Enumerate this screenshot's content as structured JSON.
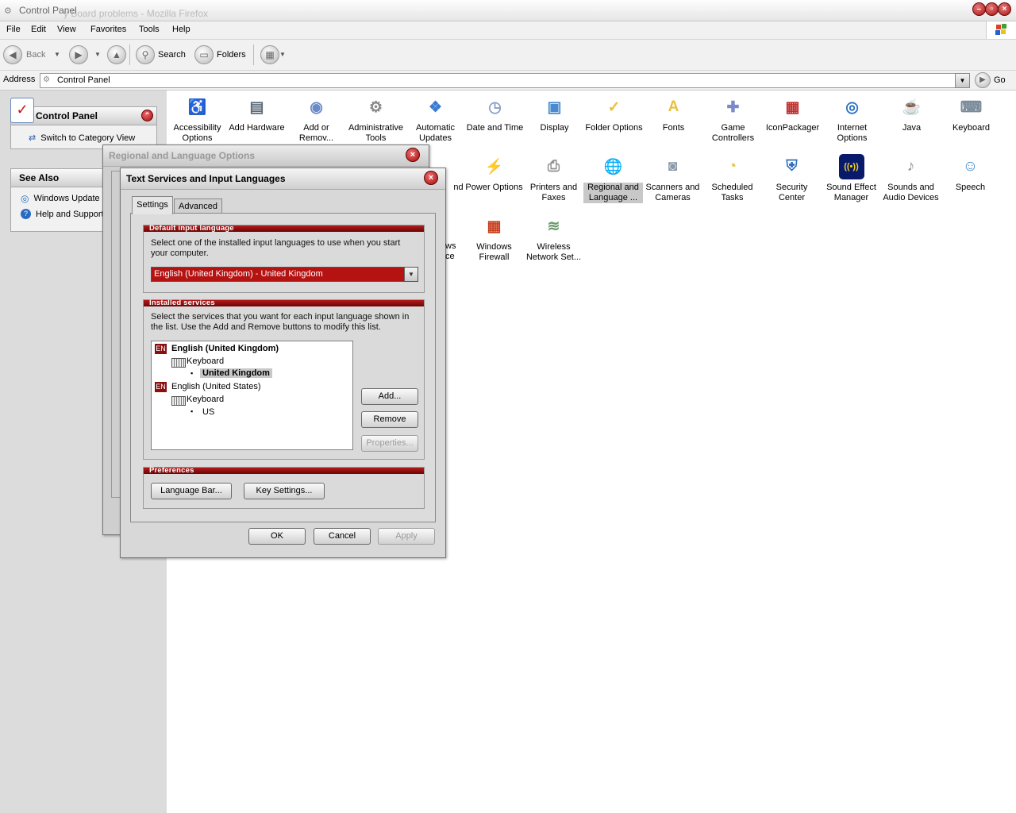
{
  "window": {
    "title": "Control Panel",
    "ghost_title": "y Board problems - Mozilla Firefox"
  },
  "menu": [
    "File",
    "Edit",
    "View",
    "Favorites",
    "Tools",
    "Help"
  ],
  "toolbar": {
    "back": "Back",
    "search": "Search",
    "folders": "Folders"
  },
  "address": {
    "label": "Address",
    "value": "Control Panel",
    "go": "Go"
  },
  "leftpane": {
    "control_panel_title": "Control Panel",
    "switch_view": "Switch to Category View",
    "see_also_title": "See Also",
    "see_also": [
      "Windows Update",
      "Help and Support"
    ]
  },
  "items": [
    {
      "label": "Accessibility Options",
      "icon": "accessibility-icon",
      "color": "#2e8b2e",
      "glyph": "♿"
    },
    {
      "label": "Add Hardware",
      "icon": "add-hardware-icon",
      "color": "#5a6a7a",
      "glyph": "▤"
    },
    {
      "label": "Add or Remov...",
      "icon": "add-remove-programs-icon",
      "color": "#6a8ac8",
      "glyph": "◉"
    },
    {
      "label": "Administrative Tools",
      "icon": "administrative-tools-icon",
      "color": "#888888",
      "glyph": "⚙"
    },
    {
      "label": "Automatic Updates",
      "icon": "automatic-updates-icon",
      "color": "#3a7ad0",
      "glyph": "❖"
    },
    {
      "label": "Date and Time",
      "icon": "date-time-icon",
      "color": "#8aa0c8",
      "glyph": "◷"
    },
    {
      "label": "Display",
      "icon": "display-icon",
      "color": "#4a8ad0",
      "glyph": "▣"
    },
    {
      "label": "Folder Options",
      "icon": "folder-options-icon",
      "color": "#e8c040",
      "glyph": "✓"
    },
    {
      "label": "Fonts",
      "icon": "fonts-icon",
      "color": "#e8c040",
      "glyph": "A"
    },
    {
      "label": "Game Controllers",
      "icon": "game-controllers-icon",
      "color": "#7a8ac8",
      "glyph": "✚"
    },
    {
      "label": "IconPackager",
      "icon": "iconpackager-icon",
      "color": "#c03030",
      "glyph": "▦"
    },
    {
      "label": "Internet Options",
      "icon": "internet-options-icon",
      "color": "#2a70c0",
      "glyph": "◎"
    },
    {
      "label": "Java",
      "icon": "java-icon",
      "color": "#d86020",
      "glyph": "☕"
    },
    {
      "label": "Keyboard",
      "icon": "keyboard-icon",
      "color": "#7a8a9a",
      "glyph": "⌨"
    },
    {
      "label": "nd",
      "icon": "partially-hidden-icon",
      "color": "#999999",
      "glyph": "",
      "label2": "..."
    },
    {
      "label": "Power Options",
      "icon": "power-options-icon",
      "color": "#8a9ab0",
      "glyph": "⚡"
    },
    {
      "label": "Printers and Faxes",
      "icon": "printers-faxes-icon",
      "color": "#909090",
      "glyph": "⎙"
    },
    {
      "label": "Regional and Language ...",
      "icon": "regional-language-icon",
      "color": "#2a6ac0",
      "glyph": "🌐"
    },
    {
      "label": "Scanners and Cameras",
      "icon": "scanners-cameras-icon",
      "color": "#8a9aa8",
      "glyph": "◙"
    },
    {
      "label": "Scheduled Tasks",
      "icon": "scheduled-tasks-icon",
      "color": "#e8c040",
      "glyph": "◔"
    },
    {
      "label": "Security Center",
      "icon": "security-center-icon",
      "color": "#3070c0",
      "glyph": "⛨"
    },
    {
      "label": "Sound Effect Manager",
      "icon": "sound-effect-manager-icon",
      "color": "#0a1a6a",
      "glyph": "((•))"
    },
    {
      "label": "Sounds and Audio Devices",
      "icon": "sounds-audio-icon",
      "color": "#909090",
      "glyph": "♪"
    },
    {
      "label": "Speech",
      "icon": "speech-icon",
      "color": "#4a90d0",
      "glyph": "☺"
    },
    {
      "label": "Windows Firewall",
      "icon": "windows-firewall-icon",
      "color": "#c84020",
      "glyph": "▦"
    },
    {
      "label": "Wireless Network Set...",
      "icon": "wireless-network-icon",
      "color": "#6a9a6a",
      "glyph": "≋"
    }
  ],
  "hidden_fragments": {
    "ws": "ws",
    "ce": "ce"
  },
  "regional_dialog": {
    "title": "Regional and Language Options"
  },
  "ts_dialog": {
    "title": "Text Services and Input Languages",
    "tabs": [
      "Settings",
      "Advanced"
    ],
    "default_group": "Default input language",
    "default_text": "Select one of the installed input languages to use when you start your computer.",
    "default_value": "English (United Kingdom) - United Kingdom",
    "installed_group": "Installed services",
    "installed_text": "Select the services that you want for each input language shown in the list. Use the Add and Remove buttons to modify this list.",
    "tree": {
      "lang1": {
        "badge": "EN",
        "name": "English (United Kingdom)",
        "type": "Keyboard",
        "layout": "United Kingdom"
      },
      "lang2": {
        "badge": "EN",
        "name": "English (United States)",
        "type": "Keyboard",
        "layout": "US"
      }
    },
    "buttons": {
      "add": "Add...",
      "remove": "Remove",
      "properties": "Properties..."
    },
    "prefs_group": "Preferences",
    "prefs_buttons": {
      "language_bar": "Language Bar...",
      "key_settings": "Key Settings..."
    },
    "footer": {
      "ok": "OK",
      "cancel": "Cancel",
      "apply": "Apply"
    }
  }
}
